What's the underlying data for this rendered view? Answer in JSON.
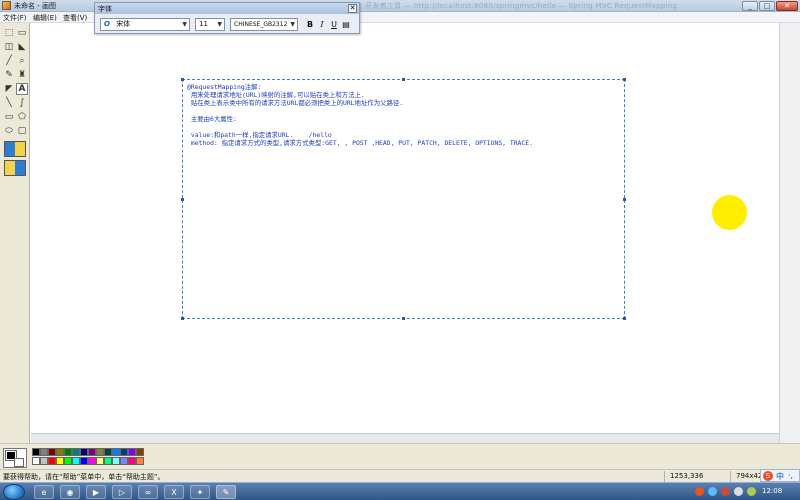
{
  "window": {
    "title": "未命名 - 画图",
    "ghost_title": "开发者工具 — http://localhost:8080/springmvc/hello — Spring MVC RequestMapping",
    "minimize": "_",
    "maximize": "□",
    "close": "✕"
  },
  "menu": {
    "items": [
      "文件(F)",
      "编辑(E)",
      "查看(V)"
    ]
  },
  "font_toolbar": {
    "title": "字体",
    "close": "✕",
    "font_icon": "O",
    "font_name": "宋体",
    "font_size": "11",
    "script": "CHINESE_GB2312",
    "bold": "B",
    "italic": "I",
    "underline": "U",
    "vertical": "▤"
  },
  "tools": {
    "icons": [
      "free-select-icon",
      "rect-select-icon",
      "eraser-icon",
      "fill-icon",
      "picker-icon",
      "magnifier-icon",
      "pencil-icon",
      "brush-icon",
      "airbrush-icon",
      "text-icon",
      "line-icon",
      "curve-icon",
      "rectangle-icon",
      "polygon-icon",
      "ellipse-icon",
      "rounded-rect-icon"
    ]
  },
  "textbox": {
    "lines": [
      "@RequestMapping注解:",
      " 用来处理请求地址(URL)映射的注解,可以贴在类上和方法上.",
      " 贴在类上表示类中所有的请求方法URL都必须把类上的URL地址作为父路径.",
      "",
      " 主要由6大属性:",
      "",
      " value:和path一样,指定请求URL.    /hello",
      " method: 指定请求方式的类型,请求方式类型:GET, , POST ,HEAD, PUT, PATCH, DELETE, OPTIONS, TRACE."
    ]
  },
  "palette": {
    "colors": [
      "#000000",
      "#808080",
      "#800000",
      "#808000",
      "#008000",
      "#008080",
      "#000080",
      "#800080",
      "#808040",
      "#004040",
      "#0080ff",
      "#004080",
      "#8000ff",
      "#804000",
      "#ffffff",
      "#c0c0c0",
      "#ff0000",
      "#ffff00",
      "#00ff00",
      "#00ffff",
      "#0000ff",
      "#ff00ff",
      "#ffff80",
      "#00ff80",
      "#80ffff",
      "#8080ff",
      "#ff0080",
      "#ff8040"
    ]
  },
  "status": {
    "help": "要获得帮助，请在“帮助”菜单中，单击“帮助主题”。",
    "coords": "1253,336",
    "size": "794x42"
  },
  "ime": {
    "s": "S",
    "zh": "中",
    "half": "·,"
  },
  "taskbar": {
    "clock": "12:08",
    "apps": [
      "ie",
      "chrome",
      "media",
      "media2",
      "vs",
      "excel",
      "tool",
      "paint"
    ]
  }
}
